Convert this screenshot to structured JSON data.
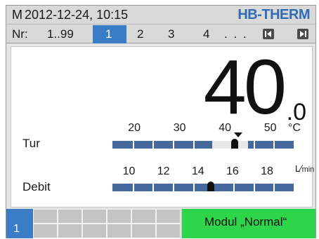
{
  "header": {
    "mode": "M",
    "datetime": "2012-12-24, 10:15",
    "brand": "HB-THERM"
  },
  "tabs": {
    "nr_label": "Nr:",
    "range": "1..99",
    "items": [
      "1",
      "2",
      "3",
      "4"
    ],
    "active": "1",
    "ellipsis": ". . .",
    "prev_icon": "page-back-icon",
    "next_icon": "page-forward-icon"
  },
  "display": {
    "value_int": "40",
    "value_dec": ".0"
  },
  "temperature": {
    "label": "Tur",
    "unit": "°C",
    "ticks": [
      "20",
      "30",
      "40",
      "50"
    ],
    "min": 15,
    "max": 55,
    "actual": 42,
    "setpoint": 40,
    "band": [
      37,
      45
    ]
  },
  "flow": {
    "label": "Debit",
    "unit_top": "L",
    "unit_bottom": "min",
    "ticks": [
      "10",
      "12",
      "14",
      "16",
      "18"
    ],
    "min": 9,
    "max": 19.5,
    "actual": 14.7
  },
  "status": {
    "module_number": "1",
    "message": "Modul „Normal“"
  },
  "colors": {
    "accent_blue": "#3b7cc7",
    "bar_blue": "#45699c",
    "ok_green": "#2ed44a",
    "brand_blue": "#2f6cb5"
  }
}
